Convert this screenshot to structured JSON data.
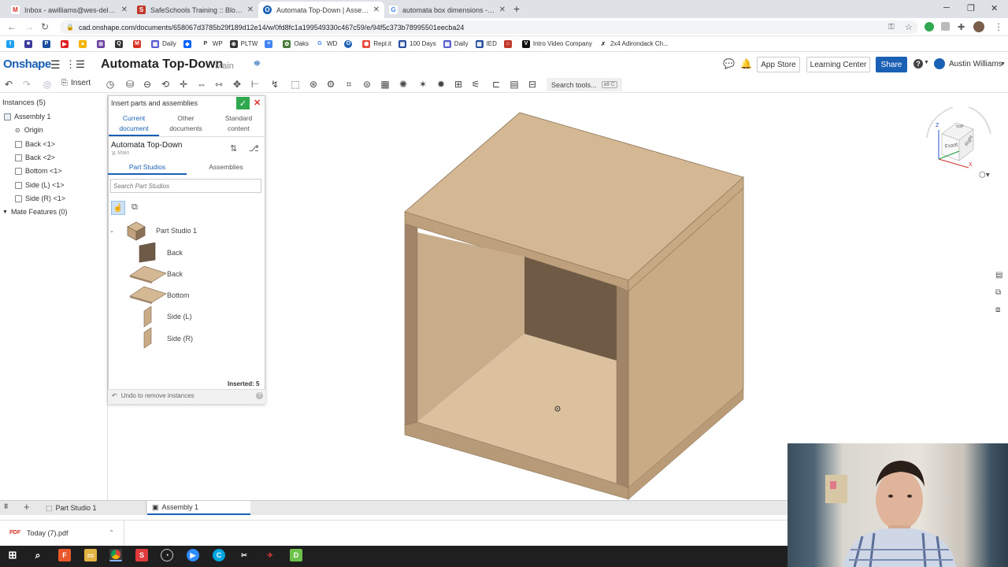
{
  "browser": {
    "tabs": [
      {
        "title": "Inbox - awilliams@wes-del.org -",
        "favicon": "gmail-icon",
        "color": "#d93025"
      },
      {
        "title": "SafeSchools Training :: Bloodbor",
        "favicon": "safeschools-icon",
        "color": "#c0392b"
      },
      {
        "title": "Automata Top-Down | Assembly",
        "favicon": "onshape-icon",
        "color": "#1a60b5"
      },
      {
        "title": "automata box dimensions - Goo",
        "favicon": "google-icon",
        "color": "#4285f4"
      }
    ],
    "new_tab": "+",
    "url": "cad.onshape.com/documents/658067d3785b29f189d12e14/w/0fd8fc1a199549330c467c59/e/94f5c373b78995501eecba24",
    "bookmarks": [
      "Daily",
      "WP",
      "PLTW",
      "Oaks",
      "WD",
      "Repl.it",
      "100 Days",
      "Daily",
      "IED",
      "Intro Video Company",
      "2x4 Adirondack Ch..."
    ]
  },
  "onshape": {
    "logo": "Onshape",
    "doc_title": "Automata Top-Down",
    "workspace": "Main",
    "app_store": "App Store",
    "learning_center": "Learning Center",
    "share": "Share",
    "help": "?",
    "user": "Austin Williams",
    "toolbar": {
      "undo_label": "Insert",
      "search_label": "Search tools...",
      "search_key": "alt C"
    }
  },
  "instances": {
    "header": "Instances (5)",
    "items": [
      "Assembly 1",
      "Origin",
      "Back <1>",
      "Back <2>",
      "Bottom <1>",
      "Side (L) <1>",
      "Side (R) <1>",
      "Mate Features (0)"
    ]
  },
  "insert_dialog": {
    "title": "Insert parts and assemblies",
    "tabs": [
      "Current document",
      "Other documents",
      "Standard content"
    ],
    "doc_name": "Automata Top-Down",
    "doc_branch": "Main",
    "subtabs": [
      "Part Studios",
      "Assemblies"
    ],
    "search_placeholder": "Search Part Studios",
    "part_studio": "Part Studio 1",
    "parts": [
      "Back",
      "Back",
      "Bottom",
      "Side (L)",
      "Side (R)"
    ],
    "inserted": "Inserted: 5",
    "undo": "Undo to remove instances"
  },
  "viewcube": {
    "top": "Top",
    "front": "Front",
    "right": "Right",
    "axis_z": "Z",
    "axis_x": "X"
  },
  "bottom_tabs": [
    "Part Studio 1",
    "Assembly 1"
  ],
  "download": {
    "file": "Today (7).pdf"
  },
  "colors": {
    "accent": "#1a60b5",
    "wood_top": "#d1b48f",
    "wood_front": "#c2a27e",
    "wood_inner": "#6e5a47",
    "confirm": "#2fa84f",
    "cancel": "#d9342b"
  }
}
